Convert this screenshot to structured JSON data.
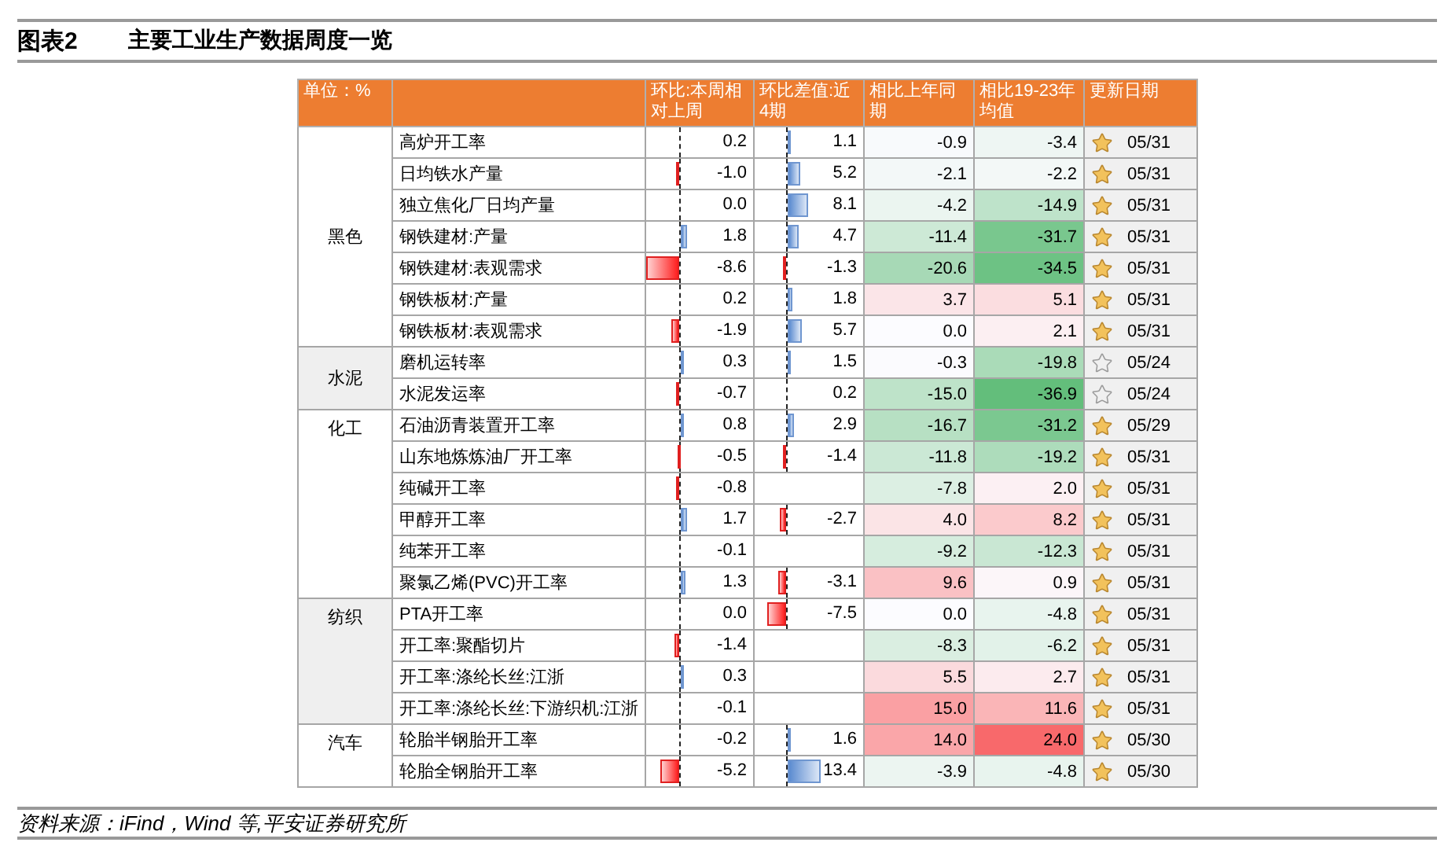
{
  "figure": {
    "label": "图表2",
    "title": "主要工业生产数据周度一览"
  },
  "table": {
    "unit": "单位：%",
    "columns": [
      "环比:本周相对上周",
      "环比差值:近4期",
      "相比上年同期",
      "相比19-23年均值",
      "更新日期"
    ],
    "groups": [
      {
        "category": "黑色",
        "rows": [
          {
            "name": "高炉开工率",
            "wow": "0.2",
            "diff": "1.1",
            "yoy": "-0.9",
            "vs_avg": "-3.4",
            "starred": true,
            "date": "05/31"
          },
          {
            "name": "日均铁水产量",
            "wow": "-1.0",
            "diff": "5.2",
            "yoy": "-2.1",
            "vs_avg": "-2.2",
            "starred": true,
            "date": "05/31"
          },
          {
            "name": "独立焦化厂日均产量",
            "wow": "0.0",
            "diff": "8.1",
            "yoy": "-4.2",
            "vs_avg": "-14.9",
            "starred": true,
            "date": "05/31"
          },
          {
            "name": "钢铁建材:产量",
            "wow": "1.8",
            "diff": "4.7",
            "yoy": "-11.4",
            "vs_avg": "-31.7",
            "starred": true,
            "date": "05/31"
          },
          {
            "name": "钢铁建材:表观需求",
            "wow": "-8.6",
            "diff": "-1.3",
            "yoy": "-20.6",
            "vs_avg": "-34.5",
            "starred": true,
            "date": "05/31"
          },
          {
            "name": "钢铁板材:产量",
            "wow": "0.2",
            "diff": "1.8",
            "yoy": "3.7",
            "vs_avg": "5.1",
            "starred": true,
            "date": "05/31"
          },
          {
            "name": "钢铁板材:表观需求",
            "wow": "-1.9",
            "diff": "5.7",
            "yoy": "0.0",
            "vs_avg": "2.1",
            "starred": true,
            "date": "05/31"
          }
        ]
      },
      {
        "category": "水泥",
        "rows": [
          {
            "name": "磨机运转率",
            "wow": "0.3",
            "diff": "1.5",
            "yoy": "-0.3",
            "vs_avg": "-19.8",
            "starred": false,
            "date": "05/24"
          },
          {
            "name": "水泥发运率",
            "wow": "-0.7",
            "diff": "0.2",
            "yoy": "-15.0",
            "vs_avg": "-36.9",
            "starred": false,
            "date": "05/24"
          }
        ]
      },
      {
        "category": "化工",
        "rows": [
          {
            "name": "石油沥青装置开工率",
            "wow": "0.8",
            "diff": "2.9",
            "yoy": "-16.7",
            "vs_avg": "-31.2",
            "starred": true,
            "date": "05/29"
          },
          {
            "name": "山东地炼炼油厂开工率",
            "wow": "-0.5",
            "diff": "-1.4",
            "yoy": "-11.8",
            "vs_avg": "-19.2",
            "starred": true,
            "date": "05/31"
          },
          {
            "name": "纯碱开工率",
            "wow": "-0.8",
            "yoy": "-7.8",
            "vs_avg": "2.0",
            "starred": true,
            "date": "05/31"
          },
          {
            "name": "甲醇开工率",
            "wow": "1.7",
            "diff": "-2.7",
            "yoy": "4.0",
            "vs_avg": "8.2",
            "starred": true,
            "date": "05/31"
          },
          {
            "name": "纯苯开工率",
            "wow": "-0.1",
            "yoy": "-9.2",
            "vs_avg": "-12.3",
            "starred": true,
            "date": "05/31"
          },
          {
            "name": "聚氯乙烯(PVC)开工率",
            "wow": "1.3",
            "diff": "-3.1",
            "yoy": "9.6",
            "vs_avg": "0.9",
            "starred": true,
            "date": "05/31"
          }
        ]
      },
      {
        "category": "纺织",
        "rows": [
          {
            "name": "PTA开工率",
            "wow": "0.0",
            "diff": "-7.5",
            "yoy": "0.0",
            "vs_avg": "-4.8",
            "starred": true,
            "date": "05/31"
          },
          {
            "name": "开工率:聚酯切片",
            "wow": "-1.4",
            "yoy": "-8.3",
            "vs_avg": "-6.2",
            "starred": true,
            "date": "05/31"
          },
          {
            "name": "开工率:涤纶长丝:江浙",
            "wow": "0.3",
            "yoy": "5.5",
            "vs_avg": "2.7",
            "starred": true,
            "date": "05/31"
          },
          {
            "name": "开工率:涤纶长丝:下游织机:江浙",
            "wow": "-0.1",
            "yoy": "15.0",
            "vs_avg": "11.6",
            "starred": true,
            "date": "05/31"
          }
        ]
      },
      {
        "category": "汽车",
        "rows": [
          {
            "name": "轮胎半钢胎开工率",
            "wow": "-0.2",
            "diff": "1.6",
            "yoy": "14.0",
            "vs_avg": "24.0",
            "starred": true,
            "date": "05/30"
          },
          {
            "name": "轮胎全钢胎开工率",
            "wow": "-5.2",
            "diff": "13.4",
            "yoy": "-3.9",
            "vs_avg": "-4.8",
            "starred": true,
            "date": "05/30"
          }
        ]
      }
    ]
  },
  "source": "资料来源：iFind，Wind 等,平安证券研究所"
}
